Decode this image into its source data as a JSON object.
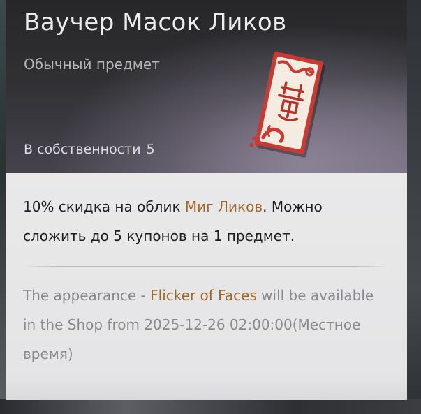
{
  "item": {
    "title": "Ваучер Масок Ликов",
    "rarity": "Обычный предмет",
    "owned_label": "В собственности",
    "owned_count": "5",
    "image_icon": "mask-voucher-icon"
  },
  "description": {
    "part1": "10% скидка на облик ",
    "highlight": "Миг Ликов",
    "part2": ". Можно сложить до 5 купонов на 1 предмет."
  },
  "availability": {
    "part1": "The appearance - ",
    "highlight": "Flicker of Faces",
    "part2": " will be available in the Shop from 2025-12-26 02:00:00(Местное время)"
  },
  "colors": {
    "accent": "#a0672a",
    "header_bg": "#2c2c2f",
    "body_bg": "#e7e7e8",
    "voucher_red": "#c83a34"
  }
}
